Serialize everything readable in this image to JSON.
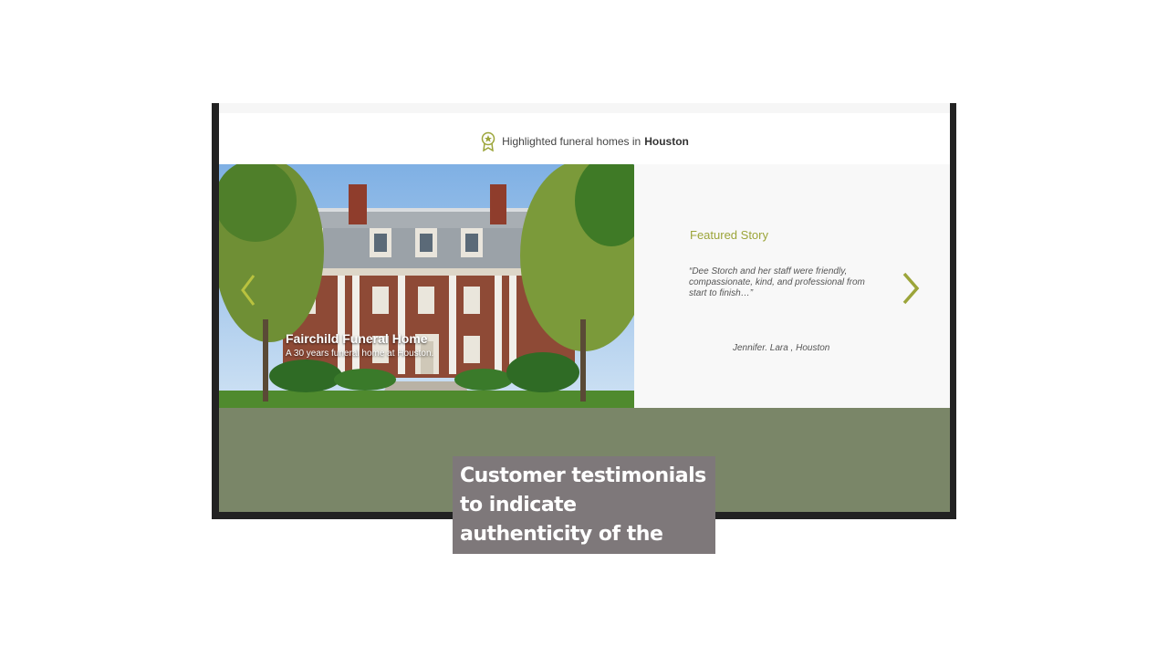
{
  "website": {
    "heading_prefix": "Highlighted funeral homes in",
    "heading_city": "Houston",
    "hero": {
      "title": "Fairchild Funeral Home",
      "subtitle": "A 30 years funeral home at Houston."
    },
    "featured": {
      "label": "Featured Story",
      "quote": "“Dee Storch and her staff were friendly, compassionate, kind, and professional from start to finish…”",
      "author": "Jennifer. Lara , Houston"
    }
  },
  "annotation": {
    "text": "Customer testimonials to indicate authenticity of the website"
  },
  "colors": {
    "accent": "#9ca53a",
    "band": "#7a8668",
    "callout_bg": "#7e787a"
  },
  "icons": [
    "award-icon",
    "chevron-left-icon",
    "chevron-right-icon"
  ]
}
